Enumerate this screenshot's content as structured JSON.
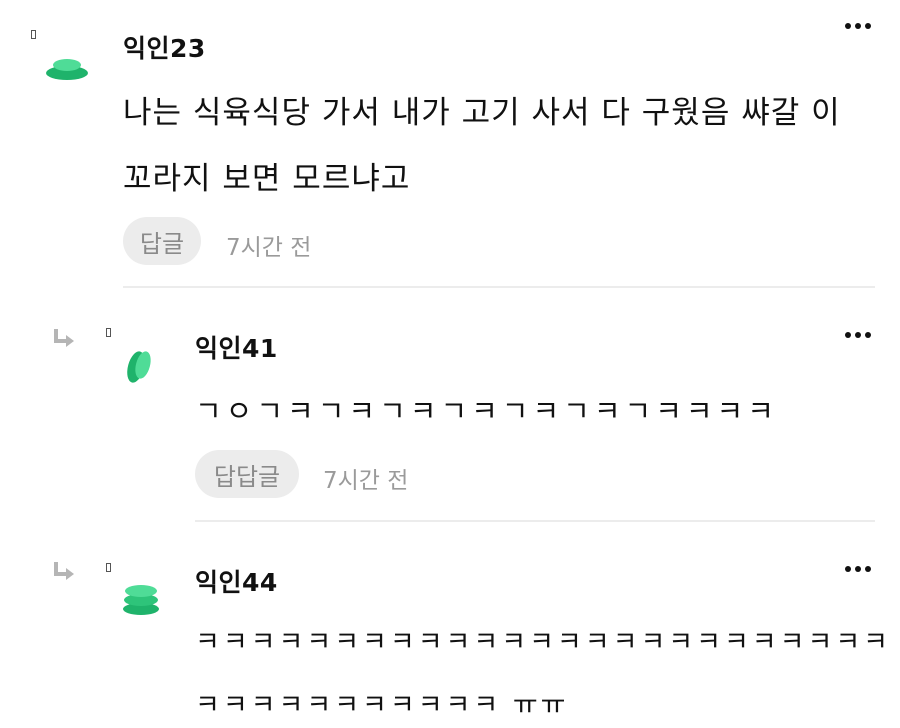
{
  "comments": [
    {
      "author": "익인23",
      "lines": [
        "나는 식육식당 가서 내가 고기 사서 다 구웠음 쌰갈 이",
        "꼬라지 보면 모르냐고"
      ],
      "reply_label": "답글",
      "time": "7시간 전",
      "avatar_icon": "leaf-avatar-icon",
      "avatar_color": "#2ec47a"
    },
    {
      "author": "익인41",
      "lines": [
        "ㄱㅇㄱㅋㄱㅋㄱㅋㄱㅋㄱㅋㄱㅋㄱㅋㅋㅋㅋ"
      ],
      "reply_label": "답답글",
      "time": "7시간 전",
      "avatar_icon": "leaf-avatar-icon",
      "avatar_color": "#2ec47a"
    },
    {
      "author": "익인44",
      "lines": [
        "ㅋㅋㅋㅋㅋㅋㅋㅋㅋㅋㅋㅋㅋㅋㅋㅋㅋㅋㅋㅋㅋㅋㅋㅋㅋ",
        "ㅋㅋㅋㅋㅋㅋㅋㅋㅋㅋㅋ ㅠㅠ"
      ],
      "avatar_icon": "leaf-avatar-icon",
      "avatar_color": "#2ec47a"
    }
  ]
}
